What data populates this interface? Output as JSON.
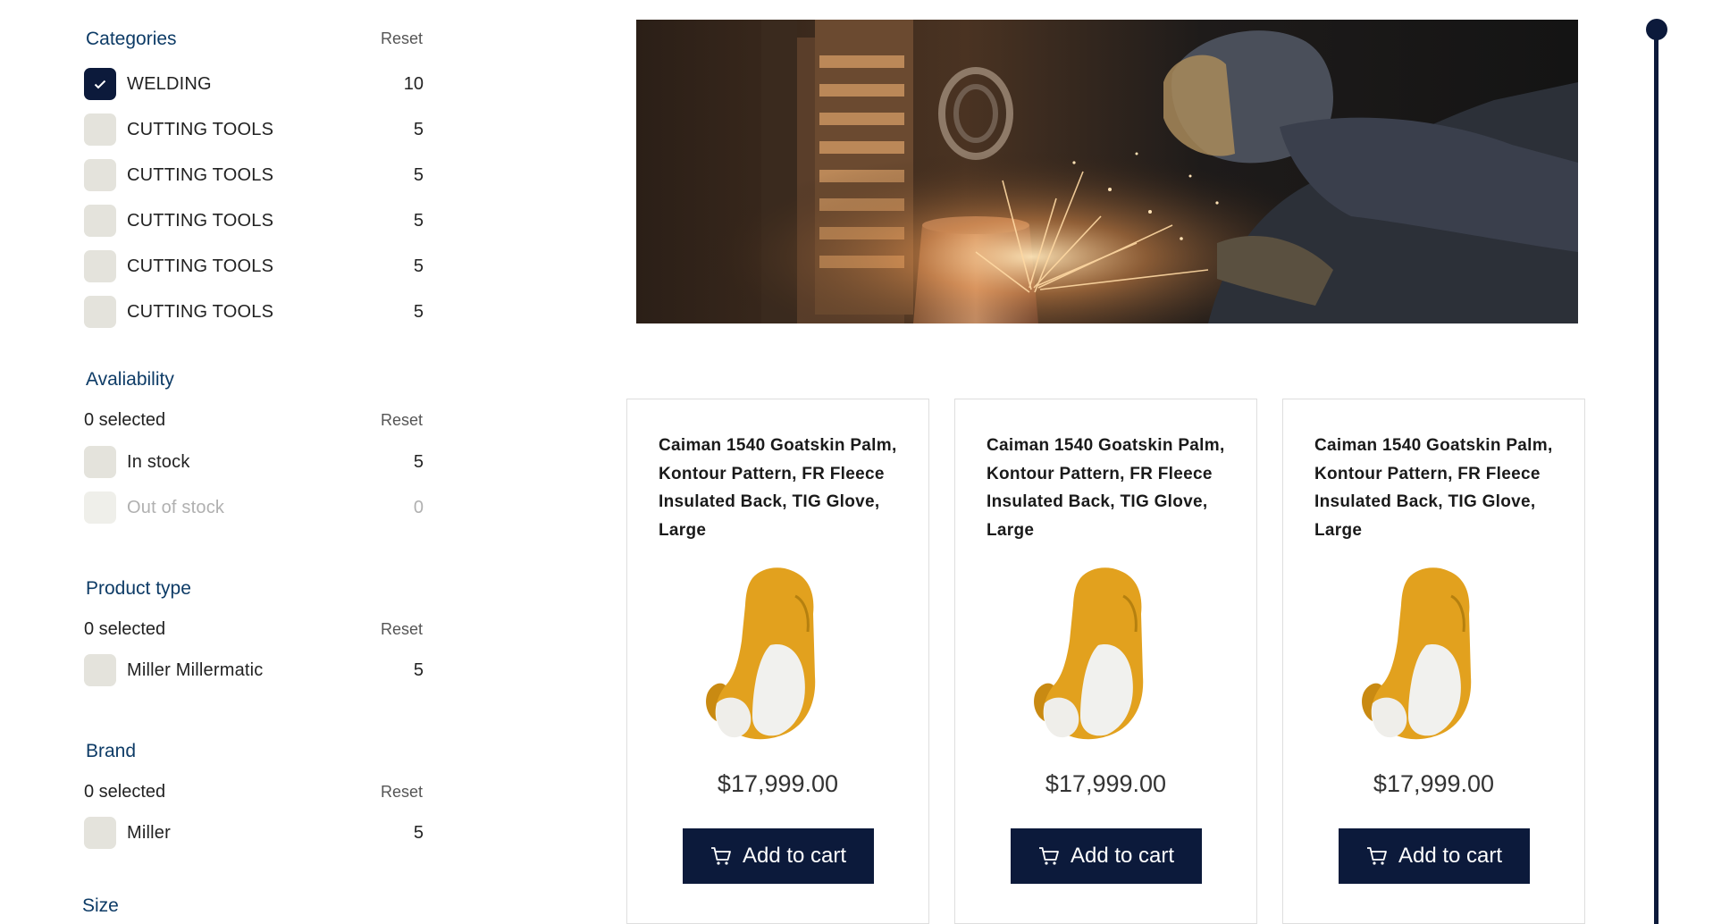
{
  "filters": {
    "categories": {
      "title": "Categories",
      "reset": "Reset",
      "options": [
        {
          "label": "WELDING",
          "count": "10",
          "checked": true
        },
        {
          "label": "CUTTING TOOLS",
          "count": "5"
        },
        {
          "label": "CUTTING TOOLS",
          "count": "5"
        },
        {
          "label": "CUTTING TOOLS",
          "count": "5"
        },
        {
          "label": "CUTTING TOOLS",
          "count": "5"
        },
        {
          "label": "CUTTING TOOLS",
          "count": "5"
        }
      ]
    },
    "availability": {
      "title": "Avaliability",
      "selected": "0 selected",
      "reset": "Reset",
      "options": [
        {
          "label": "In stock",
          "count": "5"
        },
        {
          "label": "Out of stock",
          "count": "0",
          "disabled": true
        }
      ]
    },
    "product_type": {
      "title": "Product type",
      "selected": "0 selected",
      "reset": "Reset",
      "options": [
        {
          "label": "Miller Millermatic",
          "count": "5"
        }
      ]
    },
    "brand": {
      "title": "Brand",
      "selected": "0 selected",
      "reset": "Reset",
      "options": [
        {
          "label": "Miller",
          "count": "5"
        }
      ]
    },
    "size": {
      "title": "Size"
    }
  },
  "products": [
    {
      "title": "Caiman 1540 Goatskin Palm, Kontour Pattern, FR Fleece Insulated Back, TIG Glove, Large",
      "price": "$17,999.00",
      "cta": "Add to cart"
    },
    {
      "title": "Caiman 1540 Goatskin Palm, Kontour Pattern, FR Fleece Insulated Back, TIG Glove, Large",
      "price": "$17,999.00",
      "cta": "Add to cart"
    },
    {
      "title": "Caiman 1540 Goatskin Palm, Kontour Pattern, FR Fleece Insulated Back, TIG Glove, Large",
      "price": "$17,999.00",
      "cta": "Add to cart"
    }
  ],
  "colors": {
    "brand_navy": "#0c1a3b",
    "heading_blue": "#0d3b66",
    "checkbox_grey": "#e4e3dc",
    "glove_yellow": "#e2a11e"
  },
  "icons": {
    "check": "check-icon",
    "cart": "cart-icon"
  }
}
